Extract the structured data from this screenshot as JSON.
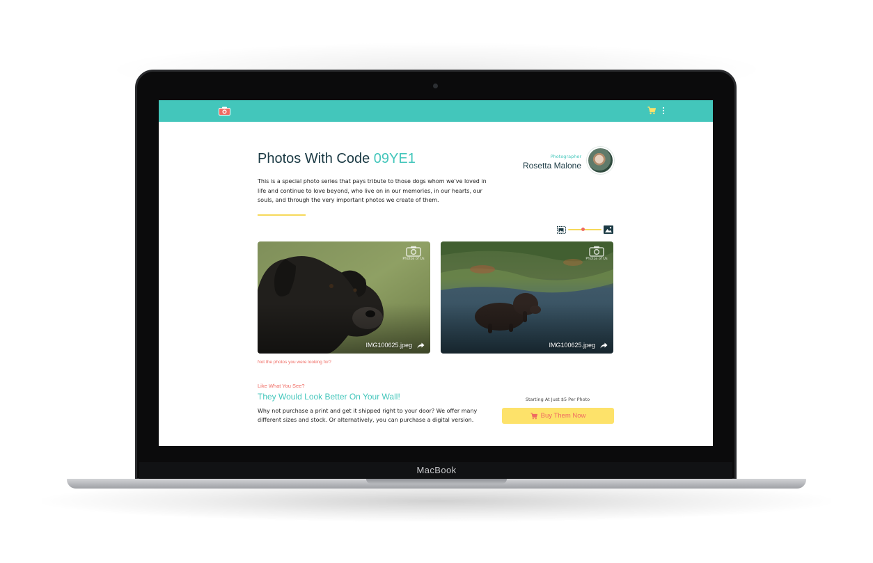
{
  "device": {
    "brand_label": "MacBook"
  },
  "page": {
    "title_prefix": "Photos With Code",
    "code": "09YE1",
    "description": "This is a special photo series that pays tribute to those dogs whom we've loved in life and continue to love beyond, who live on in our memories, in our hearts, our souls, and through the very important photos we create of them."
  },
  "photographer": {
    "label": "Photographer",
    "name": "Rosetta Malone"
  },
  "size_slider": {
    "level": 0.45
  },
  "photos": [
    {
      "filename": "IMG100625.jpeg",
      "watermark": "Photos of Us"
    },
    {
      "filename": "IMG100625.jpeg",
      "watermark": "Photos of Us"
    }
  ],
  "not_looking_link": "Not the photos you were looking for?",
  "cta": {
    "kicker": "Like What You See?",
    "heading": "They Would Look Better On Your Wall!",
    "body": "Why not purchase a print and get it shipped right to your door? We offer many different sizes and stock. Or alternatively, you can purchase a digital version.",
    "price_note": "Starting At Just $5 Per Photo",
    "button_label": "Buy Them Now"
  },
  "colors": {
    "accent": "#43c6bb",
    "coral": "#ef6a62",
    "yellow": "#fde26a",
    "navy": "#1b3a44"
  },
  "icons": [
    "camera-logo-icon",
    "cart-icon",
    "more-vert-icon",
    "image-small-icon",
    "image-large-icon",
    "share-icon",
    "camera-watermark-icon"
  ]
}
